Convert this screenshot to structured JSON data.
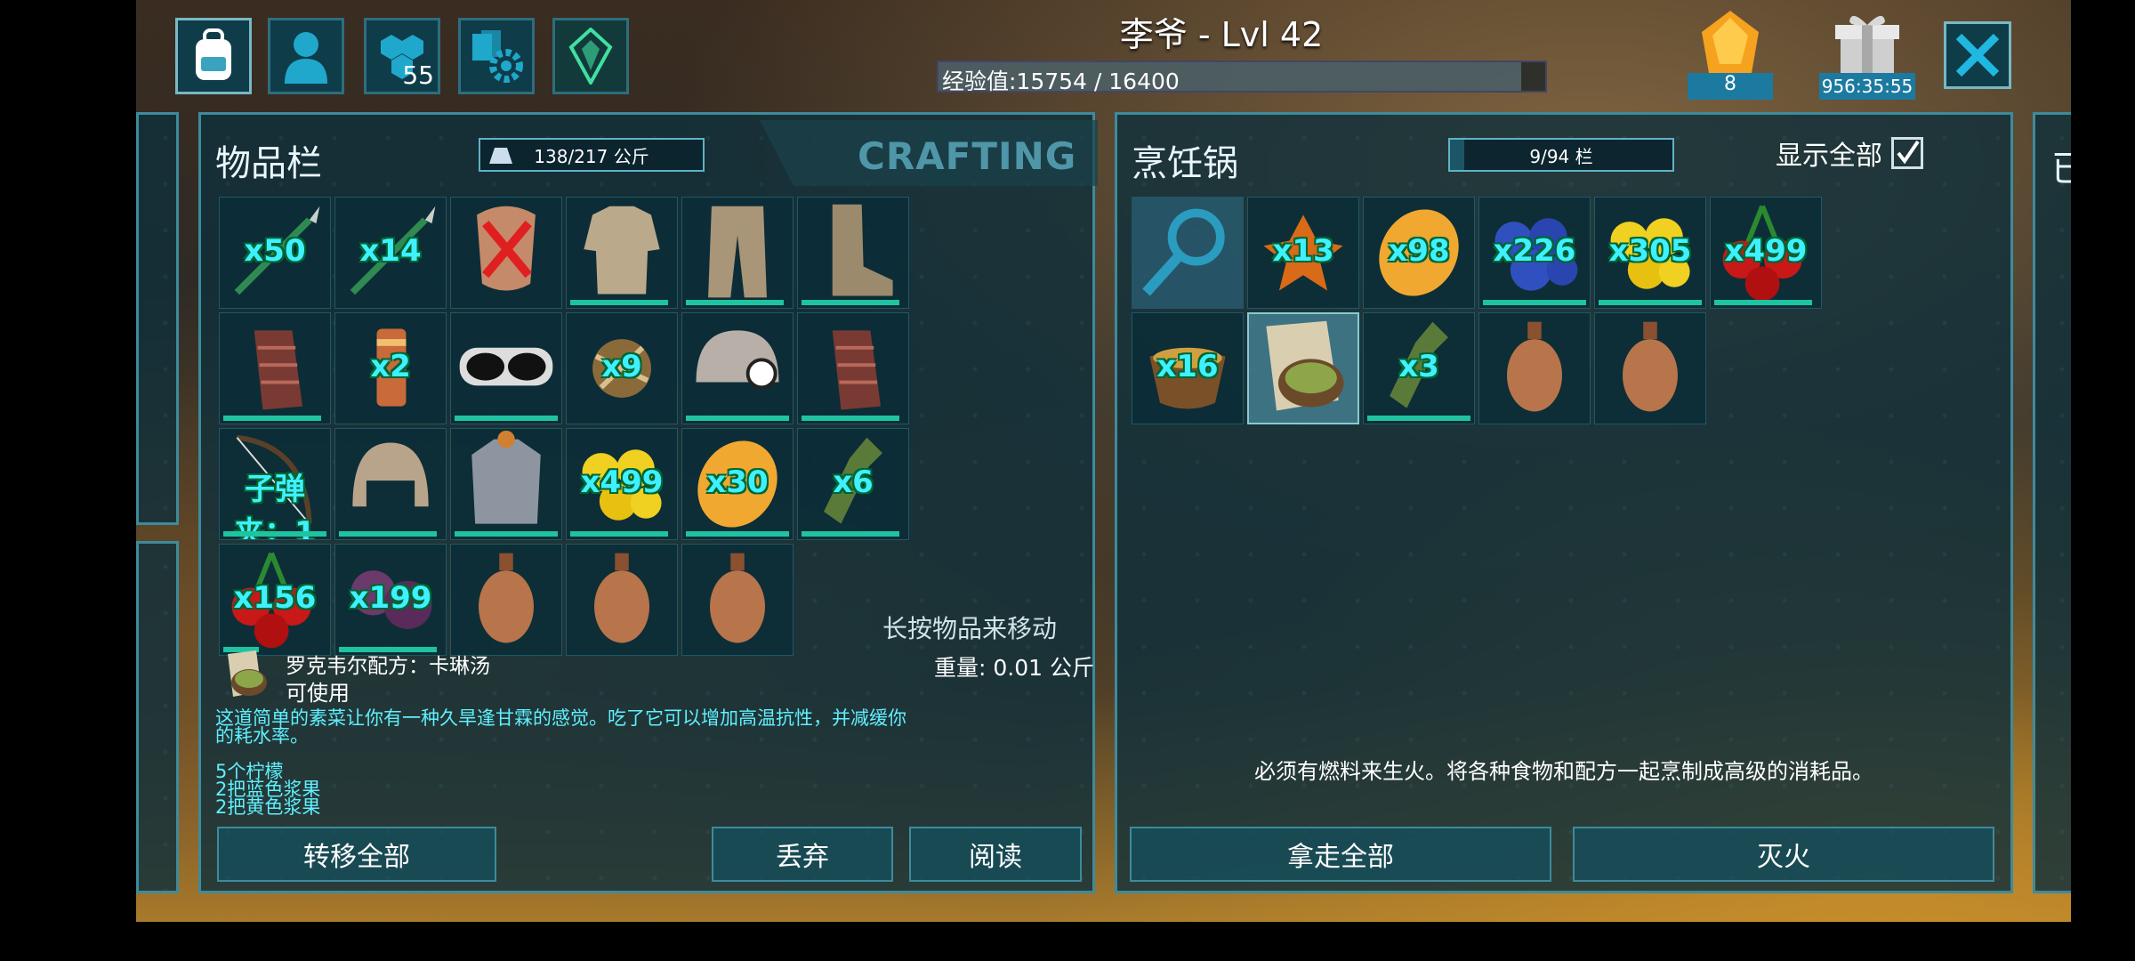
{
  "player": {
    "title": "李爷 - Lvl 42",
    "xp_text": "经验值:15754 / 16400",
    "xp_fraction": 0.96
  },
  "topbar": {
    "tabs": [
      {
        "icon": "backpack-icon"
      },
      {
        "icon": "character-icon"
      },
      {
        "icon": "engrams-icon",
        "badge": "55"
      },
      {
        "icon": "settings-icon"
      },
      {
        "icon": "tribe-crystal-icon"
      }
    ],
    "element_count": "8",
    "timer": "956:35:55"
  },
  "inventory": {
    "title": "物品栏",
    "weight_capacity": "138/217 公斤",
    "crafting_tab": "CRAFTING",
    "hint": "长按物品来移动",
    "rows": [
      [
        {
          "name": "spear-icon",
          "count": "x50"
        },
        {
          "name": "spear-icon",
          "count": "x14"
        },
        {
          "name": "chest-armor-icon",
          "count": ""
        },
        {
          "name": "shirt-icon",
          "count": ""
        },
        {
          "name": "pants-icon",
          "count": ""
        },
        {
          "name": "boots-icon",
          "count": ""
        }
      ],
      [
        {
          "name": "gloves-icon",
          "count": ""
        },
        {
          "name": "canister-icon",
          "count": "x2"
        },
        {
          "name": "goggles-icon",
          "count": ""
        },
        {
          "name": "bola-icon",
          "count": "x9"
        },
        {
          "name": "miner-helmet-icon",
          "count": ""
        },
        {
          "name": "gloves-icon",
          "count": ""
        }
      ],
      [
        {
          "name": "bow-icon",
          "count": "子弹夹：1"
        },
        {
          "name": "helmet-icon",
          "count": ""
        },
        {
          "name": "armor-icon",
          "count": ""
        },
        {
          "name": "yellow-berry-icon",
          "count": "x499"
        },
        {
          "name": "citronal-icon",
          "count": "x30"
        },
        {
          "name": "bottle-icon",
          "count": "x6"
        }
      ],
      [
        {
          "name": "red-berry-icon",
          "count": "x156"
        },
        {
          "name": "purple-berry-icon",
          "count": "x199"
        },
        {
          "name": "waterskin-icon",
          "count": ""
        },
        {
          "name": "waterskin-icon",
          "count": ""
        },
        {
          "name": "waterskin-icon",
          "count": ""
        }
      ]
    ],
    "selected": {
      "name": "罗克韦尔配方：卡琳汤",
      "status": "可使用",
      "weight": "重量: 0.01 公斤",
      "description": "这道简单的素菜让你有一种久旱逢甘霖的感觉。吃了它可以增加高温抗性，并减缓你的耗水率。",
      "ingredients": [
        "5个柠檬",
        "2把蓝色浆果",
        "2把黄色浆果"
      ]
    },
    "buttons": {
      "transfer_all": "转移全部",
      "drop": "丢弃",
      "read": "阅读"
    }
  },
  "cooking_pot": {
    "title": "烹饪锅",
    "slots": "9/94 栏",
    "show_all": "显示全部",
    "show_all_checked": true,
    "items": [
      [
        {
          "name": "search-icon",
          "count": ""
        },
        {
          "name": "spark-powder-icon",
          "count": "x13"
        },
        {
          "name": "citronal-icon",
          "count": "x98"
        },
        {
          "name": "blue-berry-icon",
          "count": "x226"
        },
        {
          "name": "yellow-berry-icon",
          "count": "x305"
        },
        {
          "name": "red-berry-icon",
          "count": "x499"
        }
      ],
      [
        {
          "name": "bowl-icon",
          "count": "x16"
        },
        {
          "name": "recipe-icon",
          "count": ""
        },
        {
          "name": "bottle-icon",
          "count": "x3"
        },
        {
          "name": "waterskin-icon",
          "count": ""
        },
        {
          "name": "waterskin-icon",
          "count": ""
        }
      ]
    ],
    "info": "必须有燃料来生火。将各种食物和配方一起烹制成高级的消耗品。",
    "buttons": {
      "take_all": "拿走全部",
      "extinguish": "灭火"
    }
  },
  "right_edge_glyph": "已",
  "colors": {
    "accent": "#3d8b9c",
    "count_text": "#3ff0ff",
    "durability": "#1fc3a0"
  }
}
